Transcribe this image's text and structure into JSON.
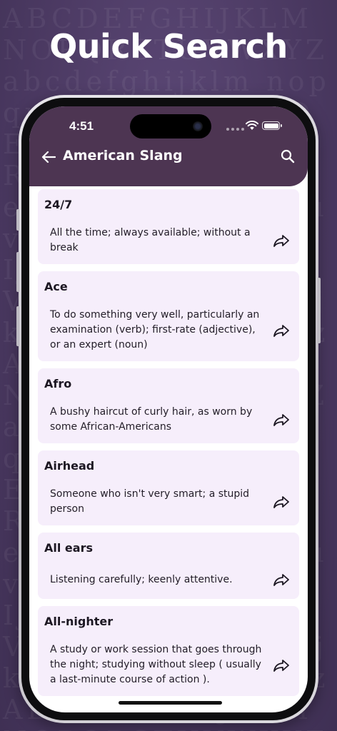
{
  "promo": {
    "headline": "Quick Search"
  },
  "status_bar": {
    "time": "4:51"
  },
  "app_bar": {
    "title": "American Slang",
    "back_icon": "arrow-left-icon",
    "search_icon": "search-icon"
  },
  "colors": {
    "app_bar": "#4d3552",
    "card_background": "#f6eefb",
    "page_background": "#4f3d66"
  },
  "entries": [
    {
      "term": "24/7",
      "definition": "All the time; always available; without a break"
    },
    {
      "term": "Ace",
      "definition": "To do something very well, particularly an examination (verb); first-rate (adjective), or an expert (noun)"
    },
    {
      "term": "Afro",
      "definition": "A bushy haircut of curly hair, as worn by some African-Americans"
    },
    {
      "term": "Airhead",
      "definition": "Someone who isn't very smart; a stupid person"
    },
    {
      "term": "All ears",
      "definition": "Listening carefully; keenly attentive."
    },
    {
      "term": "All-nighter",
      "definition": "A study or work session that goes through the night; studying without sleep ( usually a last-minute course of action )."
    }
  ]
}
